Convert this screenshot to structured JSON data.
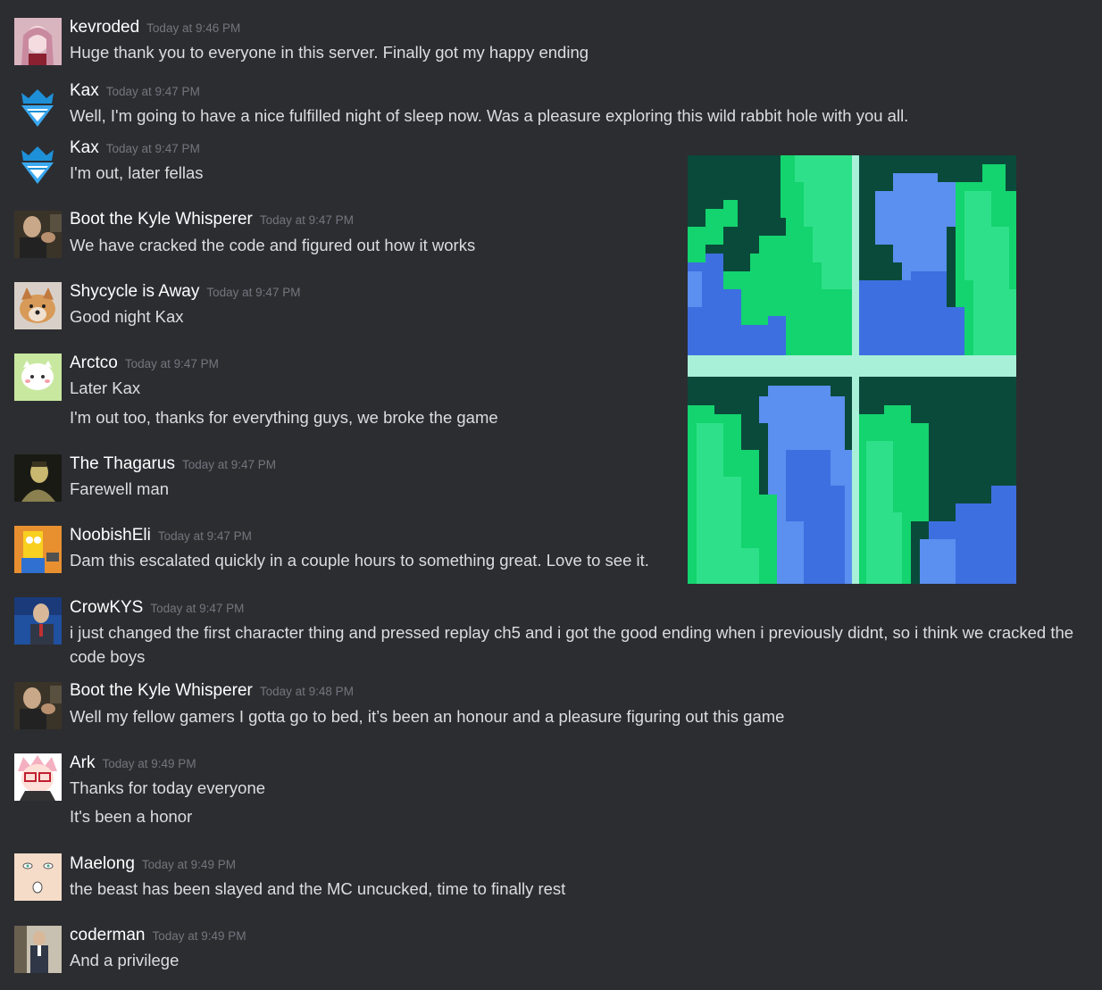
{
  "messages": [
    {
      "author": "kevroded",
      "time": "Today at 9:46 PM",
      "lines": [
        "Huge thank you to everyone in this server. Finally got my happy ending"
      ]
    },
    {
      "author": "Kax",
      "time": "Today at 9:47 PM",
      "lines": [
        "Well, I'm going to have a nice fulfilled night of sleep now. Was a pleasure exploring this wild rabbit hole with you all."
      ]
    },
    {
      "author": "Kax",
      "time": "Today at 9:47 PM",
      "lines": [
        "I'm out, later fellas"
      ]
    },
    {
      "author": "Boot the Kyle Whisperer",
      "time": "Today at 9:47 PM",
      "lines": [
        "We have cracked the code and figured out how it works"
      ]
    },
    {
      "author": "Shycycle is Away",
      "time": "Today at 9:47 PM",
      "lines": [
        "Good night Kax"
      ]
    },
    {
      "author": "Arctco",
      "time": "Today at 9:47 PM",
      "lines": [
        "Later Kax",
        "I'm out too, thanks for everything guys, we broke the game"
      ]
    },
    {
      "author": "The Thagarus",
      "time": "Today at 9:47 PM",
      "lines": [
        "Farewell man"
      ]
    },
    {
      "author": "NoobishEli",
      "time": "Today at 9:47 PM",
      "lines": [
        "Dam this escalated quickly in a couple hours to something great. Love to see it."
      ]
    },
    {
      "author": "CrowKYS",
      "time": "Today at 9:47 PM",
      "lines": [
        "i just changed the first character thing and pressed replay ch5 and i got the good ending when i previously didnt, so i think we cracked the code boys"
      ]
    },
    {
      "author": "Boot the Kyle Whisperer",
      "time": "Today at 9:48 PM",
      "lines": [
        "Well my fellow gamers I gotta go to bed, it’s been an honour and a pleasure figuring out this game"
      ]
    },
    {
      "author": "Ark",
      "time": "Today at 9:49 PM",
      "lines": [
        "Thanks for today everyone",
        "It's been a honor"
      ]
    },
    {
      "author": "Maelong",
      "time": "Today at 9:49 PM",
      "lines": [
        "the beast has been slayed and the MC uncucked, time to finally rest"
      ]
    },
    {
      "author": "coderman",
      "time": "Today at 9:49 PM",
      "lines": [
        "And a privilege"
      ]
    }
  ],
  "colors": {
    "background": "#2c2d31",
    "username": "#ffffff",
    "timestamp": "#72767d",
    "text": "#dcddde"
  },
  "attachment": {
    "type": "pixel-art-image",
    "palette": [
      "#0a4a3a",
      "#13d46e",
      "#2fe08a",
      "#3d6fe0",
      "#5b8ff0",
      "#a8f0d8"
    ]
  }
}
